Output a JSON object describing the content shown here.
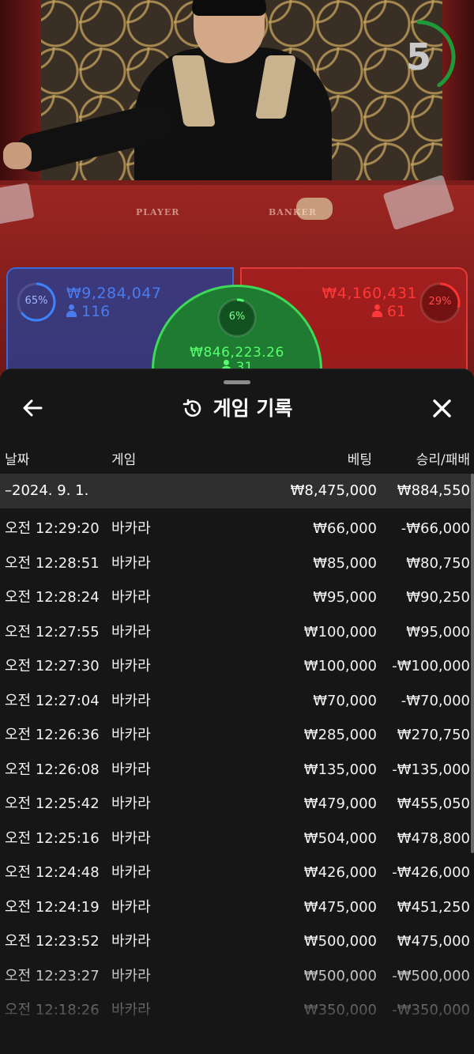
{
  "table": {
    "countdown": "5",
    "countdown_fraction": 0.4,
    "felt_labels": {
      "player": "PLAYER",
      "banker": "BANKER"
    }
  },
  "bets": {
    "player": {
      "percent": "65%",
      "percent_value": 0.65,
      "amount": "₩9,284,047",
      "count": "116",
      "color": "#3c69d8"
    },
    "banker": {
      "percent": "29%",
      "percent_value": 0.29,
      "amount": "₩4,160,431",
      "count": "61",
      "color": "#e03a3a"
    },
    "tie": {
      "percent": "6%",
      "percent_value": 0.06,
      "amount": "₩846,223.26",
      "count": "31",
      "color": "#3fd95a"
    }
  },
  "history": {
    "title": "게임 기록",
    "icons": {
      "back": "arrow-left-icon",
      "close": "close-icon",
      "history": "history-icon"
    },
    "columns": {
      "date": "날짜",
      "game": "게임",
      "bet": "베팅",
      "result": "승리/패배"
    },
    "date_group": {
      "date": "–2024. 9. 1.",
      "bet_total": "₩8,475,000",
      "result_total": "₩884,550"
    },
    "rows": [
      {
        "time": "오전 12:29:20",
        "game": "바카라",
        "bet": "₩66,000",
        "result": "-₩66,000"
      },
      {
        "time": "오전 12:28:51",
        "game": "바카라",
        "bet": "₩85,000",
        "result": "₩80,750"
      },
      {
        "time": "오전 12:28:24",
        "game": "바카라",
        "bet": "₩95,000",
        "result": "₩90,250"
      },
      {
        "time": "오전 12:27:55",
        "game": "바카라",
        "bet": "₩100,000",
        "result": "₩95,000"
      },
      {
        "time": "오전 12:27:30",
        "game": "바카라",
        "bet": "₩100,000",
        "result": "-₩100,000"
      },
      {
        "time": "오전 12:27:04",
        "game": "바카라",
        "bet": "₩70,000",
        "result": "-₩70,000"
      },
      {
        "time": "오전 12:26:36",
        "game": "바카라",
        "bet": "₩285,000",
        "result": "₩270,750"
      },
      {
        "time": "오전 12:26:08",
        "game": "바카라",
        "bet": "₩135,000",
        "result": "-₩135,000"
      },
      {
        "time": "오전 12:25:42",
        "game": "바카라",
        "bet": "₩479,000",
        "result": "₩455,050"
      },
      {
        "time": "오전 12:25:16",
        "game": "바카라",
        "bet": "₩504,000",
        "result": "₩478,800"
      },
      {
        "time": "오전 12:24:48",
        "game": "바카라",
        "bet": "₩426,000",
        "result": "-₩426,000"
      },
      {
        "time": "오전 12:24:19",
        "game": "바카라",
        "bet": "₩475,000",
        "result": "₩451,250"
      },
      {
        "time": "오전 12:23:52",
        "game": "바카라",
        "bet": "₩500,000",
        "result": "₩475,000"
      },
      {
        "time": "오전 12:23:27",
        "game": "바카라",
        "bet": "₩500,000",
        "result": "-₩500,000"
      },
      {
        "time": "오전 12:18:26",
        "game": "바카라",
        "bet": "₩350,000",
        "result": "-₩350,000"
      }
    ]
  }
}
